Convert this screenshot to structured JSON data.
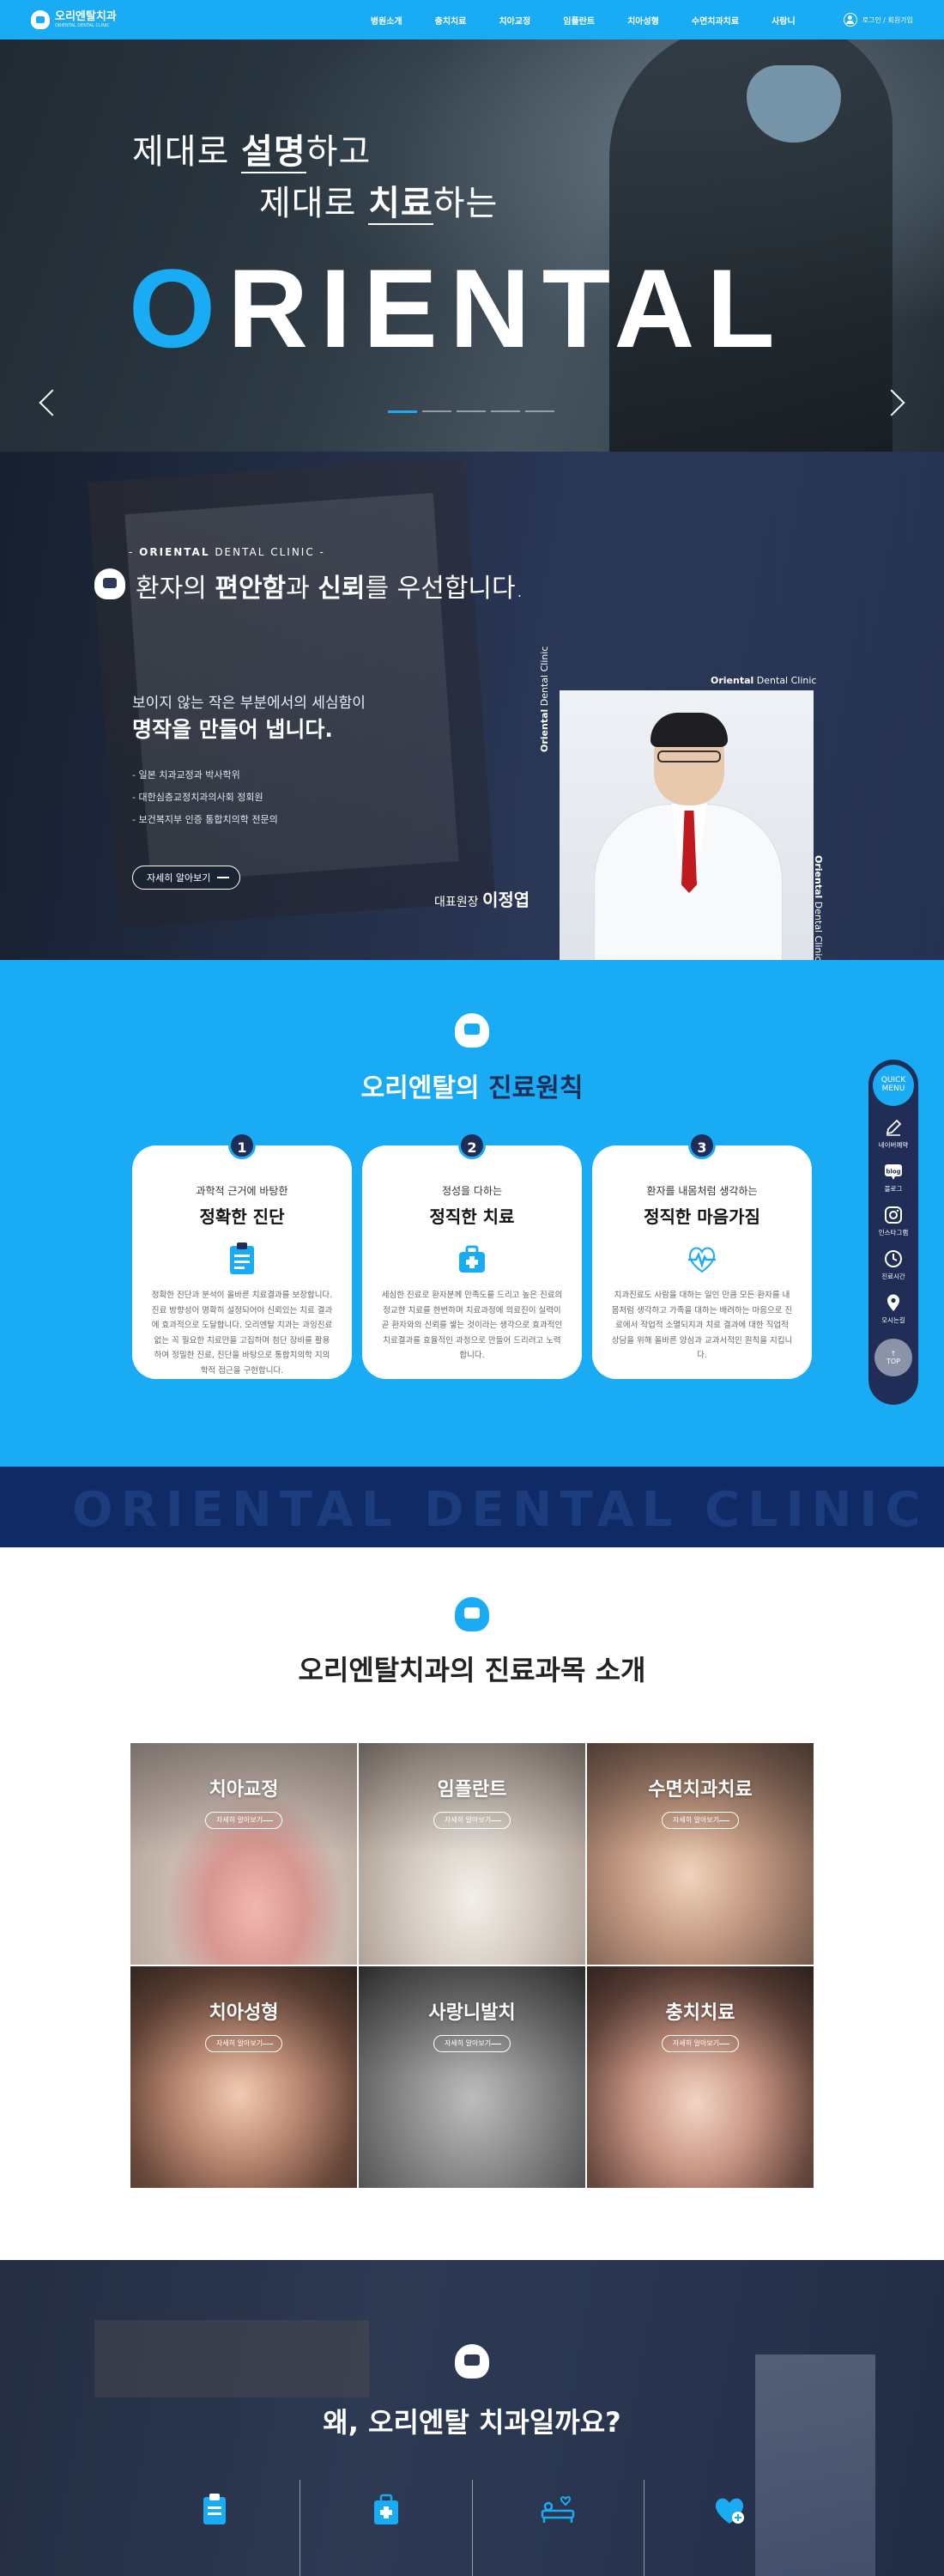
{
  "header": {
    "logo_name": "오리엔탈치과",
    "logo_sub": "ORIENTAL DENTAL CLINIC",
    "nav": [
      "병원소개",
      "충치치료",
      "치아교정",
      "임플란트",
      "치아성형",
      "수면치과치료",
      "사랑니"
    ],
    "login_label": "로그인 / 회원가입"
  },
  "hero": {
    "line1_pre": "제대로 ",
    "line1_bold": "설명",
    "line1_post": "하고",
    "line2_pre": "제대로 ",
    "line2_bold": "치료",
    "line2_post": "하는",
    "brand_first": "O",
    "brand_rest": "RIENTAL",
    "slide_count": 5,
    "active_slide": 1
  },
  "about": {
    "eyebrow_bold": "ORIENTAL",
    "eyebrow_rest": " DENTAL CLINIC",
    "title_pre": "환자의 ",
    "title_bold1": "편안함",
    "title_mid": "과 ",
    "title_bold2": "신뢰",
    "title_post": "를 우선합니다.",
    "sub1": "보이지 않는 작은 부분에서의 세심함이",
    "sub2": "명작을 만들어 냅니다.",
    "bullets": [
      "일본 치과교정과 박사학위",
      "대한심층교정치과의사회 정회원",
      "보건복지부 인증 통합치의학 전문의"
    ],
    "button_label": "자세히 알아보기",
    "card_caption_bold": "Oriental",
    "card_caption_rest": " Dental Clinic",
    "doctor_title": "대표원장 ",
    "doctor_name": "이정엽"
  },
  "principles": {
    "title_pre": "오리엔탈의 ",
    "title_bold": "진료원칙",
    "cards": [
      {
        "num": "1",
        "sub": "과학적 근거에 바탕한",
        "title": "정확한 진단",
        "icon": "clipboard-icon",
        "body": "정확한 진단과 분석이 올바른 치료결과를 보장합니다. 진료 방향성이 명확히 설정되어야 신뢰있는 치료 결과에 효과적으로 도달합니다. 오리엔탈 치과는 과잉진료 없는 꼭 필요한 치료만을 고집하며 첨단 장비를 활용하여 정밀한 진료, 진단을 바탕으로 통합치의학 지의학적 접근을 구현합니다."
      },
      {
        "num": "2",
        "sub": "정성을 다하는",
        "title": "정직한 치료",
        "icon": "first-aid-kit-icon",
        "body": "세심한 진료로 환자분께 만족도를 드리고 높은 진료의 정교한 치료를 한번하며 치료과정에 의료진이 실력이 곧 환자와의 신뢰를 쌓는 것이라는 생각으로 효과적인 치료결과를 효율적인 과정으로 만들어 드리려고 노력합니다."
      },
      {
        "num": "3",
        "sub": "환자를 내몸처럼 생각하는",
        "title": "정직한 마음가짐",
        "icon": "heartbeat-icon",
        "body": "치과진료도 사람을 대하는 일인 만큼 모든 환자를 내 몸처럼 생각하고 가족을 대하는 배려하는 마음으로 진료에서 작업적 소멸되지과 치료 결과에 대한 직업적 상담을 위해 올바른 양심과 교과서적인 원칙을 지킵니다."
      }
    ]
  },
  "quick_menu": {
    "head": "QUICK MENU",
    "items": [
      {
        "label": "네이버예약",
        "icon": "pencil-icon"
      },
      {
        "label": "블로그",
        "icon": "blog-icon"
      },
      {
        "label": "인스타그램",
        "icon": "instagram-icon"
      },
      {
        "label": "진료시간",
        "icon": "clock-icon"
      },
      {
        "label": "오시는길",
        "icon": "location-pin-icon"
      }
    ],
    "top_label": "TOP"
  },
  "banner": {
    "text": "ORIENTAL DENTAL CLINIC"
  },
  "departments": {
    "title_pre": "오리엔탈치과의 ",
    "title_bold": "진료과목 소개",
    "button_label": "자세히 알아보기",
    "tiles": [
      {
        "name": "치아교정"
      },
      {
        "name": "임플란트"
      },
      {
        "name": "수면치과치료"
      },
      {
        "name": "치아성형"
      },
      {
        "name": "사랑니발치"
      },
      {
        "name": "충치치료"
      }
    ]
  },
  "why": {
    "title_pre": "왜, ",
    "title_bold1": "오리엔탈 ",
    "title_bold2": "치과",
    "title_post": "일까요?",
    "icons": [
      "clipboard-icon",
      "first-aid-kit-icon",
      "bed-icon",
      "heart-icon"
    ]
  },
  "colors": {
    "accent": "#1aabf5",
    "navy": "#1f2d57",
    "banner": "#0f2a65"
  }
}
